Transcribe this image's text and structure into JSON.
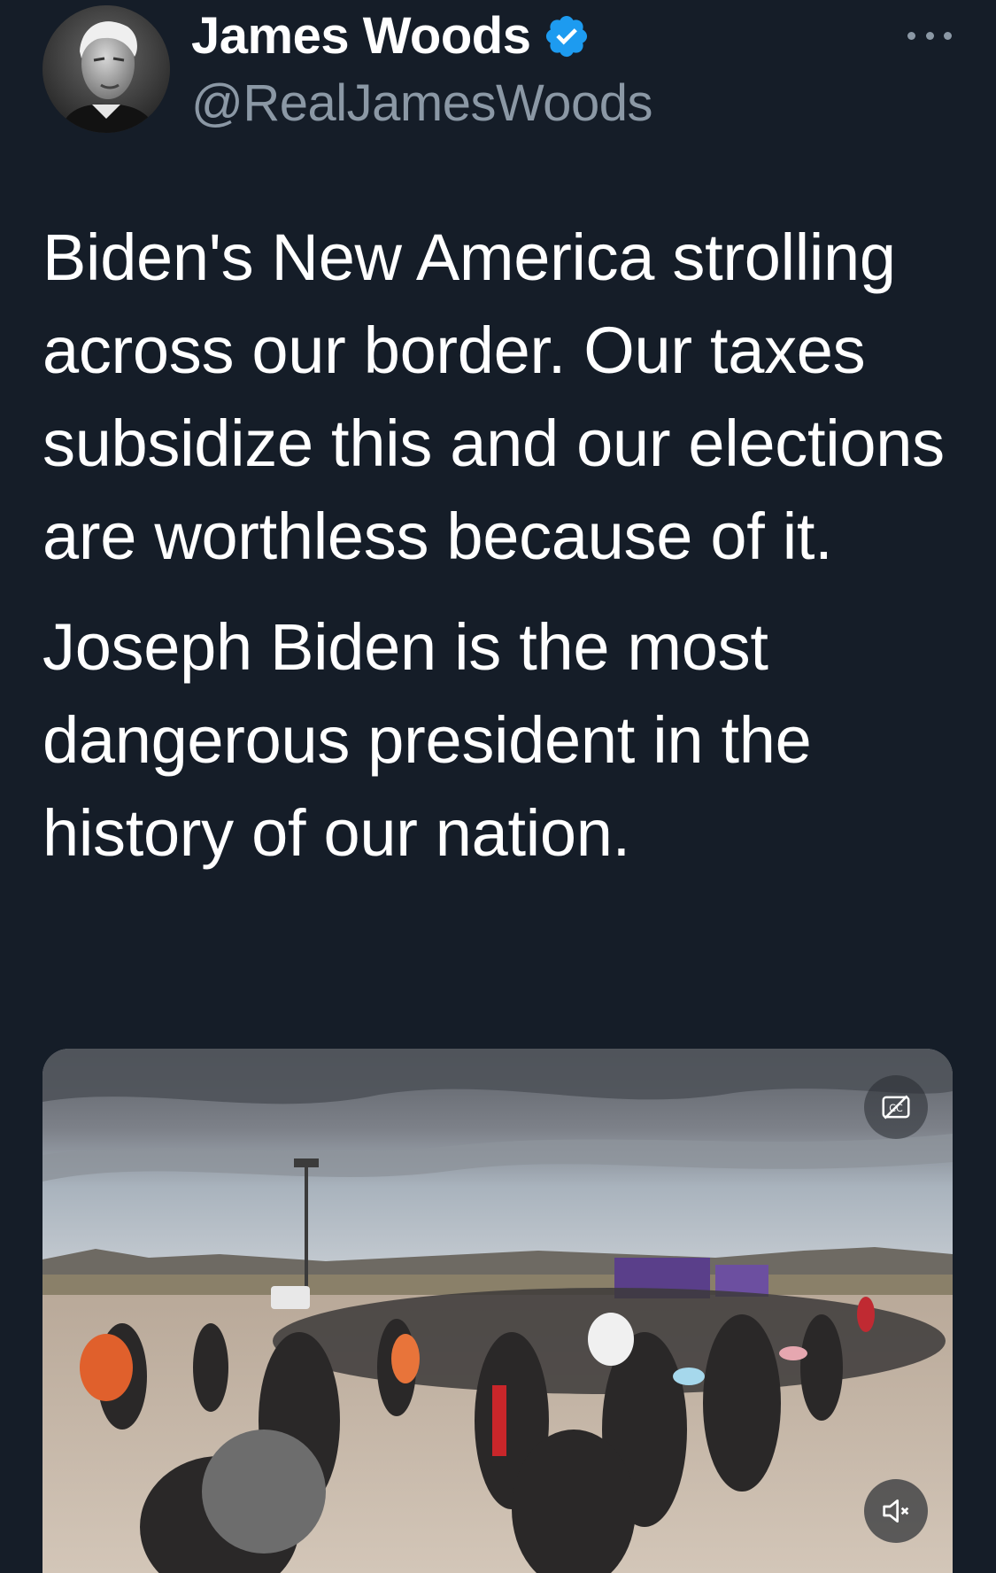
{
  "author": {
    "display_name": "James Woods",
    "handle": "@RealJamesWoods",
    "verified": true,
    "verified_color": "#1d9bf0",
    "avatar_icon": "avatar-portrait"
  },
  "header": {
    "more_icon": "more-horizontal-icon"
  },
  "tweet": {
    "paragraph_1": "Biden's New America strolling across our border. Our taxes subsidize this and our elections are worthless because of it.",
    "paragraph_2": "Joseph Biden is the most dangerous president in the history of our nation."
  },
  "media": {
    "type": "video",
    "captions_icon": "closed-captions-off-icon",
    "mute_icon": "volume-muted-icon"
  },
  "colors": {
    "background": "#151d28",
    "text_primary": "#ffffff",
    "text_secondary": "#8b98a5"
  }
}
